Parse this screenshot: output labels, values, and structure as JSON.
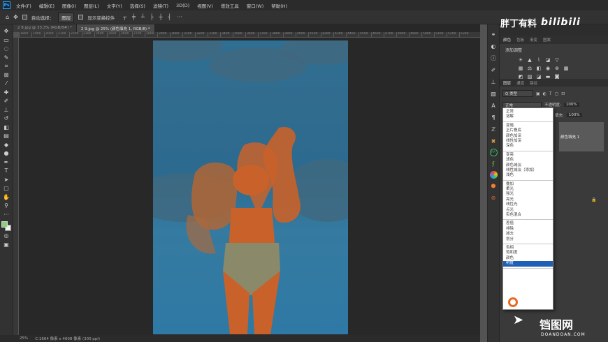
{
  "app": {
    "logo": "Ps",
    "menu": [
      "文件(F)",
      "编辑(E)",
      "图像(I)",
      "图层(L)",
      "文字(Y)",
      "选择(S)",
      "滤镜(T)",
      "3D(D)",
      "视图(V)",
      "增效工具",
      "窗口(W)",
      "帮助(H)"
    ]
  },
  "options": {
    "home_icon": "home-icon",
    "move_icon": "move-icon",
    "auto_select_label": "自动选择：",
    "auto_select_value": "图层",
    "transform_label": "显示变换控件",
    "align_icons": [
      "align-top-icon",
      "align-vcenter-icon",
      "align-bottom-icon",
      "align-left-icon",
      "align-hcenter-icon",
      "align-right-icon",
      "more-icon"
    ]
  },
  "tabs": [
    {
      "label": "2 8.jpg @ 33.3% (RGB/8#) *",
      "active": false
    },
    {
      "label": "2 9.jpg @ 25% (颜色填充 1, RGB/8) *",
      "active": true
    }
  ],
  "ruler_ticks": [
    "1800",
    "1900",
    "2000",
    "2100",
    "2200",
    "2300",
    "2400",
    "2500",
    "2600",
    "2700",
    "2800",
    "2900",
    "3000",
    "3100",
    "3200",
    "3300",
    "3400",
    "3500",
    "3600",
    "3700",
    "3800",
    "3900",
    "4000",
    "4100",
    "4200",
    "4300",
    "4400",
    "4500",
    "4600",
    "4700",
    "4800",
    "4900",
    "5000",
    "5100",
    "5200",
    "5300"
  ],
  "status": {
    "zoom": "25%",
    "doc_info": "C:1664 像素 x 4608 像素 (300 ppi)"
  },
  "panels": {
    "top_tabs": [
      "颜色",
      "色板",
      "渐变",
      "图案"
    ],
    "adjustments_title": "添加调整",
    "layers_tabs": [
      "图层",
      "通道",
      "路径"
    ],
    "kind_label": "Q 类型",
    "blend_current": "正常",
    "opacity_label": "不透明度:",
    "opacity_value": "100%",
    "fill_label": "填充:",
    "fill_value": "100%",
    "layer_name": "颜色填充 1"
  },
  "blend_modes": [
    [
      "正常",
      "溶解"
    ],
    [
      "变暗",
      "正片叠底",
      "颜色加深",
      "线性加深",
      "深色"
    ],
    [
      "变亮",
      "滤色",
      "颜色减淡",
      "线性减淡（添加）",
      "浅色"
    ],
    [
      "叠加",
      "柔光",
      "强光",
      "亮光",
      "线性光",
      "点光",
      "实色混合"
    ],
    [
      "差值",
      "排除",
      "减去",
      "划分"
    ],
    [
      "色相",
      "饱和度",
      "颜色",
      "明度"
    ]
  ],
  "selected_blend_mode": "明度",
  "watermarks": {
    "top_text": "胖丁有料",
    "top_bili": "bilibili",
    "bottom_cn": "铛图网",
    "bottom_en": "DOANDOAN.COM"
  },
  "colors": {
    "foreground": "#8ed07a",
    "background": "#f2f2f2",
    "selection": "#1f5fb5",
    "photo_blue": "#2f6f93",
    "figure_orange": "#c9622a"
  }
}
